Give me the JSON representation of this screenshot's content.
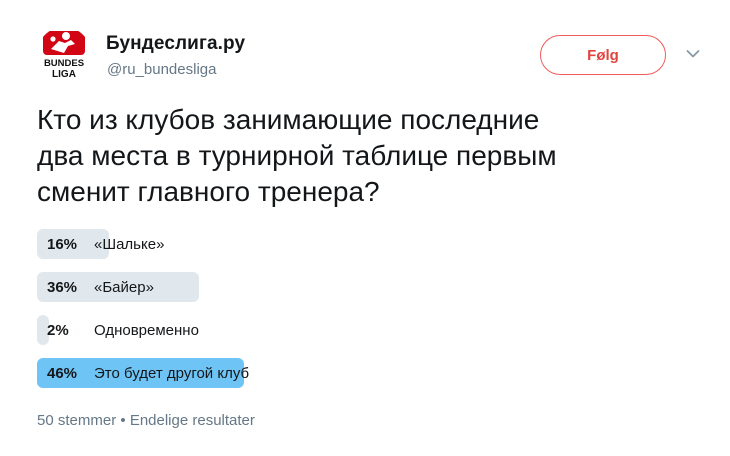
{
  "account": {
    "display_name": "Бундеслига.ру",
    "handle": "@ru_bundesliga",
    "avatar_text_top": "BUNDES",
    "avatar_text_bottom": "LIGA",
    "avatar_icon": "bundesliga-logo",
    "brand_color": "#d20515"
  },
  "follow_button": {
    "label": "Følg",
    "color": "#e0453f"
  },
  "menu_icon": "chevron-down-icon",
  "tweet": {
    "text": "Кто из клубов  занимающие последние\nдва места в турнирной таблице первым\nсменит главного тренера?"
  },
  "poll": {
    "options": [
      {
        "percent_label": "16%",
        "percent": 16,
        "label": "«Шальке»",
        "winner": false
      },
      {
        "percent_label": "36%",
        "percent": 36,
        "label": "«Байер»",
        "winner": false
      },
      {
        "percent_label": "2%",
        "percent": 2,
        "label": "Одновременно",
        "winner": false
      },
      {
        "percent_label": "46%",
        "percent": 46,
        "label": "Это будет другой клуб",
        "winner": true
      }
    ],
    "bar_color": "#e1e8ed",
    "winner_color": "#6fc4f6"
  },
  "meta": {
    "votes": "50 stemmer",
    "separator": "•",
    "status": "Endelige resultater"
  }
}
